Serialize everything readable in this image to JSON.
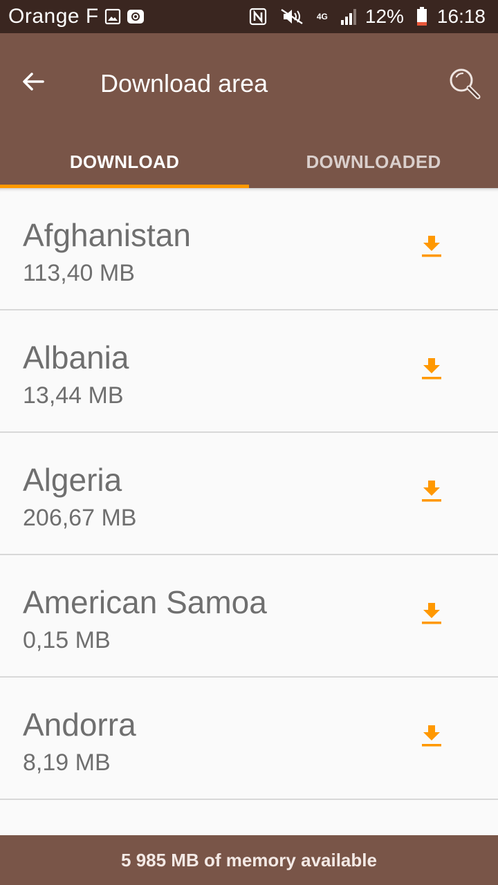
{
  "status_bar": {
    "carrier": "Orange F",
    "network": "4G",
    "battery": "12%",
    "time": "16:18",
    "icons": [
      "gallery-icon",
      "at-sign-icon",
      "nfc-icon",
      "mute-icon",
      "signal-icon",
      "battery-icon"
    ]
  },
  "app_bar": {
    "title": "Download area",
    "back_icon": "arrow-left-icon",
    "search_icon": "search-icon",
    "color": "#795548"
  },
  "tabs": [
    {
      "label": "DOWNLOAD",
      "active": true
    },
    {
      "label": "DOWNLOADED",
      "active": false
    }
  ],
  "accent_color": "#ff9800",
  "countries": [
    {
      "name": "Afghanistan",
      "size": "113,40 MB"
    },
    {
      "name": "Albania",
      "size": "13,44 MB"
    },
    {
      "name": "Algeria",
      "size": "206,67 MB"
    },
    {
      "name": "American Samoa",
      "size": "0,15 MB"
    },
    {
      "name": "Andorra",
      "size": "8,19 MB"
    }
  ],
  "footer": {
    "memory_text": "5 985 MB of memory available"
  }
}
